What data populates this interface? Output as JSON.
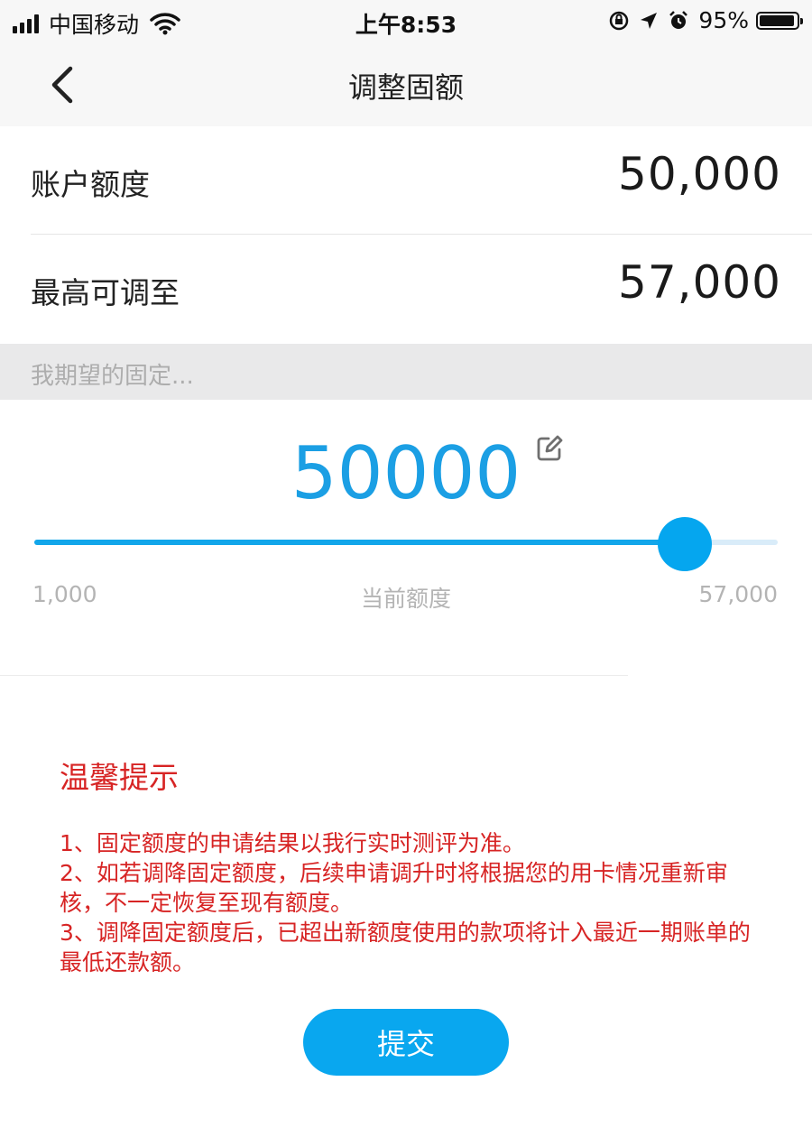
{
  "status_bar": {
    "carrier": "中国移动",
    "time": "上午8:53",
    "battery": "95%",
    "battery_level": 0.95
  },
  "nav": {
    "title": "调整固额"
  },
  "account_limit": {
    "label": "账户额度",
    "value": "50,000"
  },
  "max_adjustable": {
    "label": "最高可调至",
    "value": "57,000"
  },
  "expected_input": {
    "placeholder": "我期望的固定..."
  },
  "amount": {
    "value": "50000"
  },
  "slider": {
    "min": 1000,
    "max": 57000,
    "value": 50000,
    "min_label": "1,000",
    "max_label": "57,000",
    "current_label": "当前额度"
  },
  "tips": {
    "title": "温馨提示",
    "items": [
      "1、固定额度的申请结果以我行实时测评为准。",
      "2、如若调降固定额度，后续申请调升时将根据您的用卡情况重新审核，不一定恢复至现有额度。",
      "3、调降固定额度后，已超出新额度使用的款项将计入最近一期账单的最低还款额。"
    ]
  },
  "submit": {
    "label": "提交"
  },
  "colors": {
    "accent": "#09a7ef",
    "warning": "#d72424"
  }
}
